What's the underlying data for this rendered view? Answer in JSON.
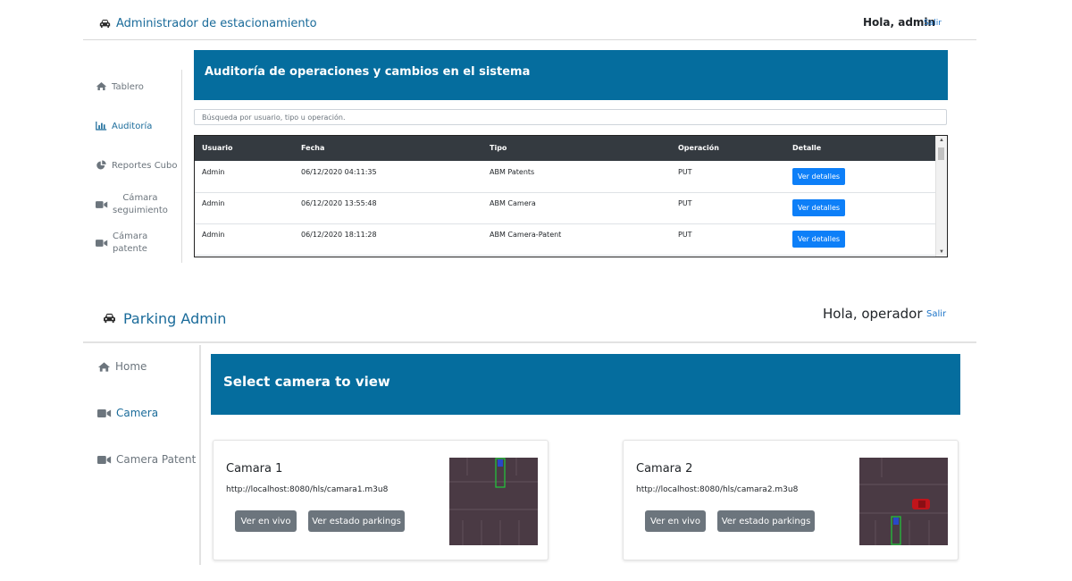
{
  "top": {
    "brand": "Administrador de estacionamiento",
    "greeting": "Hola, admin",
    "logout": "Salir",
    "sidebar": [
      {
        "label": "Tablero",
        "icon": "home-icon"
      },
      {
        "label": "Auditoría",
        "icon": "bar-chart-icon",
        "active": true
      },
      {
        "label": "Reportes Cubo",
        "icon": "pie-chart-icon"
      },
      {
        "label": "Cámara seguimiento",
        "line1": "Cámara",
        "line2": "seguimiento",
        "icon": "video-camera-icon"
      },
      {
        "label": "Cámara patente",
        "line1": "Cámara",
        "line2": "patente",
        "icon": "video-camera-icon"
      }
    ],
    "banner_title": "Auditoría de operaciones y cambios en el sistema",
    "search_placeholder": "Búsqueda por usuario, tipo u operación.",
    "table": {
      "columns": [
        "Usuario",
        "Fecha",
        "Tipo",
        "Operación",
        "Detalle"
      ],
      "rows": [
        {
          "usuario": "Admin",
          "fecha": "06/12/2020 04:11:35",
          "tipo": "ABM Patents",
          "operacion": "PUT",
          "detalle": "Ver detalles"
        },
        {
          "usuario": "Admin",
          "fecha": "06/12/2020 13:55:48",
          "tipo": "ABM Camera",
          "operacion": "PUT",
          "detalle": "Ver detalles"
        },
        {
          "usuario": "Admin",
          "fecha": "06/12/2020 18:11:28",
          "tipo": "ABM Camera-Patent",
          "operacion": "PUT",
          "detalle": "Ver detalles"
        }
      ]
    },
    "colors": {
      "banner": "#056d9e",
      "table_header": "#343a40",
      "detail_button": "#0d7ff8"
    }
  },
  "bottom": {
    "brand": "Parking Admin",
    "greeting": "Hola, operador",
    "logout": "Salir",
    "sidebar": [
      {
        "label": "Home",
        "icon": "home-icon"
      },
      {
        "label": "Camera",
        "icon": "video-camera-icon",
        "active": true
      },
      {
        "label": "Camera Patent",
        "icon": "video-camera-icon"
      }
    ],
    "banner_title": "Select camera to view",
    "cards": [
      {
        "title": "Camara 1",
        "url": "http://localhost:8080/hls/camara1.m3u8",
        "live_button": "Ver en vivo",
        "status_button": "Ver estado parkings"
      },
      {
        "title": "Camara 2",
        "url": "http://localhost:8080/hls/camara2.m3u8",
        "live_button": "Ver en vivo",
        "status_button": "Ver estado parkings"
      }
    ],
    "colors": {
      "banner": "#056d9e",
      "card_button": "#6c757d"
    }
  }
}
